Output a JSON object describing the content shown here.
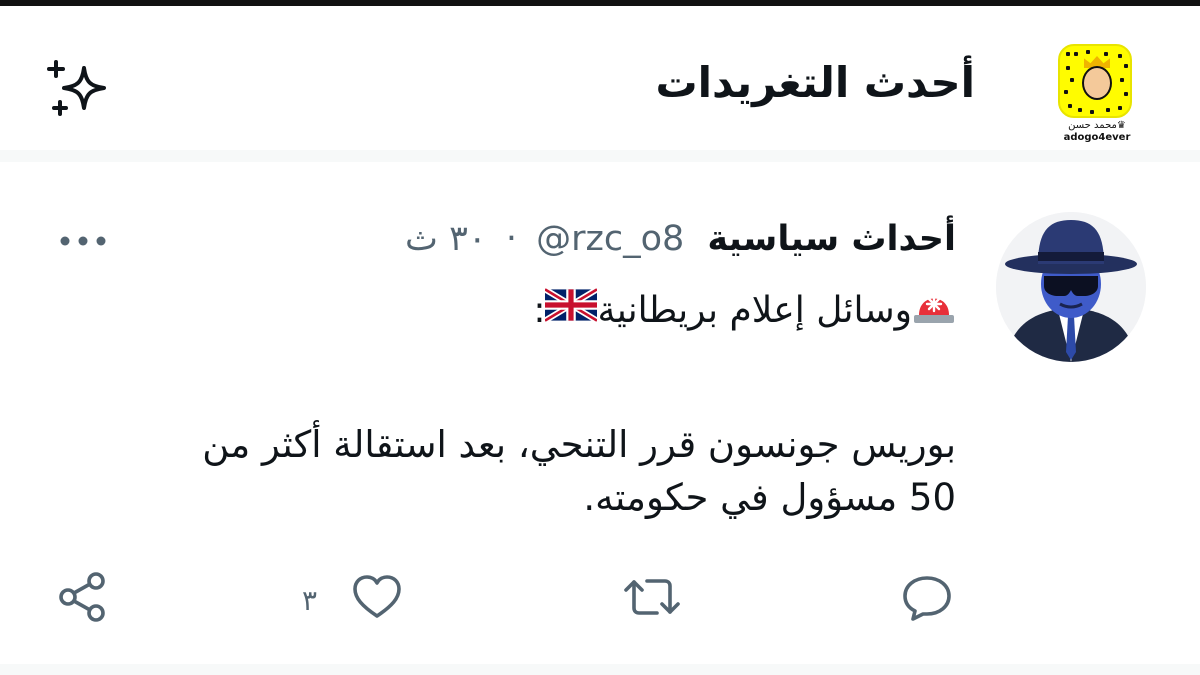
{
  "header": {
    "title": "أحدث التغريدات",
    "snapcode": {
      "caption_line1": "محمد حسن♛",
      "caption_line2": "adogo4ever"
    },
    "sparkle_icon": "sparkle-icon"
  },
  "tweet": {
    "display_name": "أحداث سياسية",
    "handle": "@rzc_o8",
    "separator": "·",
    "time": "٣٠ ث",
    "line1_text": "وسائل إعلام بريطانية",
    "line1_suffix": ":",
    "body_line1": "بوريس جونسون قرر التنحي، بعد استقالة أكثر من",
    "body_line2": "50 مسؤول في حكومته.",
    "emoji_siren": "police-light-icon",
    "emoji_flag": "uk-flag-icon",
    "more_icon": "more-icon"
  },
  "actions": {
    "reply_icon": "reply-icon",
    "retweet_icon": "retweet-icon",
    "like_icon": "heart-icon",
    "like_count": "٣",
    "share_icon": "share-icon"
  },
  "colors": {
    "text": "#0f1419",
    "secondary": "#536471",
    "snap_yellow": "#fffc00",
    "divider": "#f7f9f9"
  }
}
